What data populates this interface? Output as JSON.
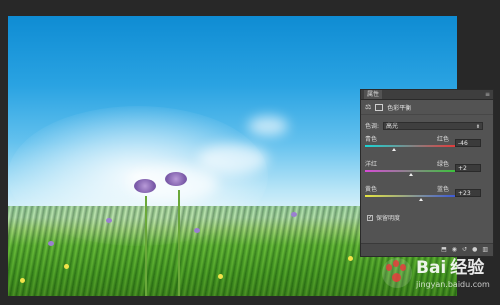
{
  "properties_panel": {
    "tab_label": "属性",
    "menu_glyph": "≡",
    "close_glyph": "«",
    "title": "色彩平衡",
    "tone": {
      "label": "色调:",
      "value": "高光"
    },
    "sliders": [
      {
        "left": "青色",
        "right": "红色",
        "value": "-46",
        "fraction": 0.32
      },
      {
        "left": "洋红",
        "right": "绿色",
        "value": "+2",
        "fraction": 0.51
      },
      {
        "left": "黄色",
        "right": "蓝色",
        "value": "+23",
        "fraction": 0.62
      }
    ],
    "preserve": {
      "label": "保留明度",
      "checked": true
    },
    "footer_icons": [
      "clip-icon",
      "visibility-icon",
      "reset-icon",
      "eye-icon",
      "trash-icon"
    ]
  },
  "watermark": {
    "brand": "Bai",
    "brand2": "经验",
    "sub": "jingyan.baidu.com"
  },
  "colors": {
    "panel": "#535353",
    "canvas": "#282828"
  }
}
